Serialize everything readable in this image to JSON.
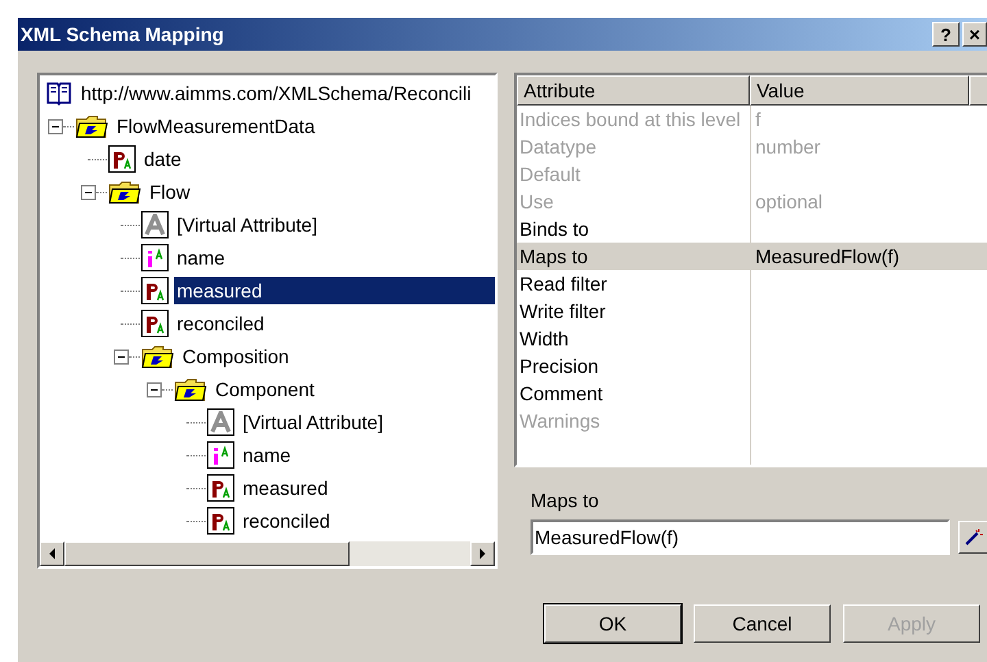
{
  "window": {
    "title": "XML Schema Mapping",
    "help_button": "?",
    "close_button": "×"
  },
  "tree": [
    {
      "kind": "root",
      "label": "http://www.aimms.com/XMLSchema/Reconcili",
      "selected": false,
      "children": [
        {
          "kind": "element",
          "label": "FlowMeasurementData",
          "selected": false,
          "expanded": true,
          "children": [
            {
              "kind": "parameter",
              "label": "date",
              "selected": false
            },
            {
              "kind": "element",
              "label": "Flow",
              "selected": false,
              "expanded": true,
              "children": [
                {
                  "kind": "virtual",
                  "label": "[Virtual Attribute]",
                  "selected": false
                },
                {
                  "kind": "index",
                  "label": "name",
                  "selected": false
                },
                {
                  "kind": "parameter",
                  "label": "measured",
                  "selected": true
                },
                {
                  "kind": "parameter",
                  "label": "reconciled",
                  "selected": false
                },
                {
                  "kind": "element",
                  "label": "Composition",
                  "selected": false,
                  "expanded": true,
                  "children": [
                    {
                      "kind": "element",
                      "label": "Component",
                      "selected": false,
                      "expanded": true,
                      "children": [
                        {
                          "kind": "virtual",
                          "label": "[Virtual Attribute]",
                          "selected": false
                        },
                        {
                          "kind": "index",
                          "label": "name",
                          "selected": false
                        },
                        {
                          "kind": "parameter",
                          "label": "measured",
                          "selected": false
                        },
                        {
                          "kind": "parameter",
                          "label": "reconciled",
                          "selected": false
                        }
                      ]
                    }
                  ]
                }
              ]
            }
          ]
        }
      ]
    }
  ],
  "grid": {
    "columns": [
      "Attribute",
      "Value"
    ],
    "rows": [
      {
        "attribute": "Indices bound at this level",
        "value": "f",
        "disabled": true,
        "selected": false
      },
      {
        "attribute": "Datatype",
        "value": "number",
        "disabled": true,
        "selected": false
      },
      {
        "attribute": "Default",
        "disabled": true,
        "selected": false
      },
      {
        "attribute": "Use",
        "value": "optional",
        "disabled": true,
        "selected": false
      },
      {
        "attribute": "Binds to",
        "disabled": false,
        "selected": false
      },
      {
        "attribute": "Maps to",
        "value": "MeasuredFlow(f)",
        "disabled": false,
        "selected": true
      },
      {
        "attribute": "Read filter",
        "disabled": false,
        "selected": false
      },
      {
        "attribute": "Write filter",
        "disabled": false,
        "selected": false
      },
      {
        "attribute": "Width",
        "disabled": false,
        "selected": false
      },
      {
        "attribute": "Precision",
        "disabled": false,
        "selected": false
      },
      {
        "attribute": "Comment",
        "disabled": false,
        "selected": false
      },
      {
        "attribute": "Warnings",
        "disabled": true,
        "selected": false
      }
    ]
  },
  "editor": {
    "label": "Maps to",
    "value": "MeasuredFlow(f)"
  },
  "buttons": [
    {
      "label": "OK",
      "disabled": false
    },
    {
      "label": "Cancel",
      "disabled": false
    },
    {
      "label": "Apply",
      "disabled": true
    }
  ]
}
